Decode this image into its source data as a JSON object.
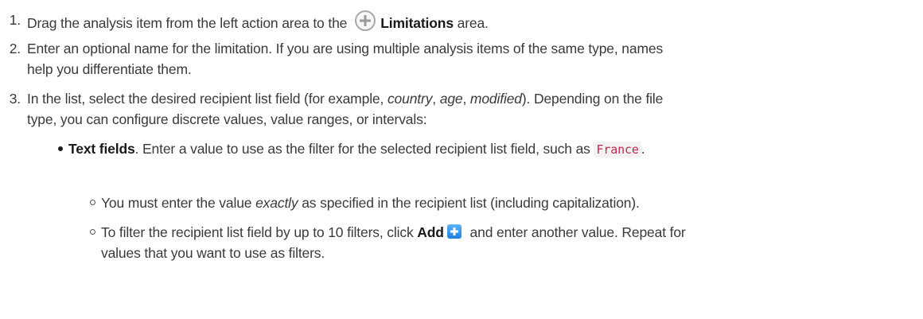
{
  "steps": [
    {
      "number": "1.",
      "text_before": "Drag the analysis item from the left action area to the",
      "bold": "Limitations",
      "text_after": " area."
    },
    {
      "number": "2.",
      "line1": "Enter an optional name for the limitation. If you are using multiple analysis items of the same type, names",
      "line2": "help you differentiate them."
    },
    {
      "number": "3.",
      "l1_a": "In the list, select the desired recipient list field (for example, ",
      "l1_country": "country",
      "l1_sep1": ", ",
      "l1_age": "age",
      "l1_sep2": ", ",
      "l1_modified": "modified",
      "l1_b": "). Depending on the file",
      "line2": "type, you can configure discrete values, value ranges, or intervals:"
    }
  ],
  "bullet": {
    "bold": "Text fields",
    "text": ". Enter a value to use as the filter for the selected recipient list field, such as ",
    "code": "France",
    "end": "."
  },
  "subbullets": [
    {
      "a": "You must enter the value ",
      "em": "exactly",
      "b": " as specified in the recipient list (including capitalization)."
    },
    {
      "a": "To filter the recipient list field by up to 10 filters, click ",
      "bold": "Add",
      "b": " and enter another value. Repeat for",
      "line2": "values that you want to use as filters."
    }
  ],
  "icons": [
    "plus-circle-icon",
    "add-icon"
  ]
}
